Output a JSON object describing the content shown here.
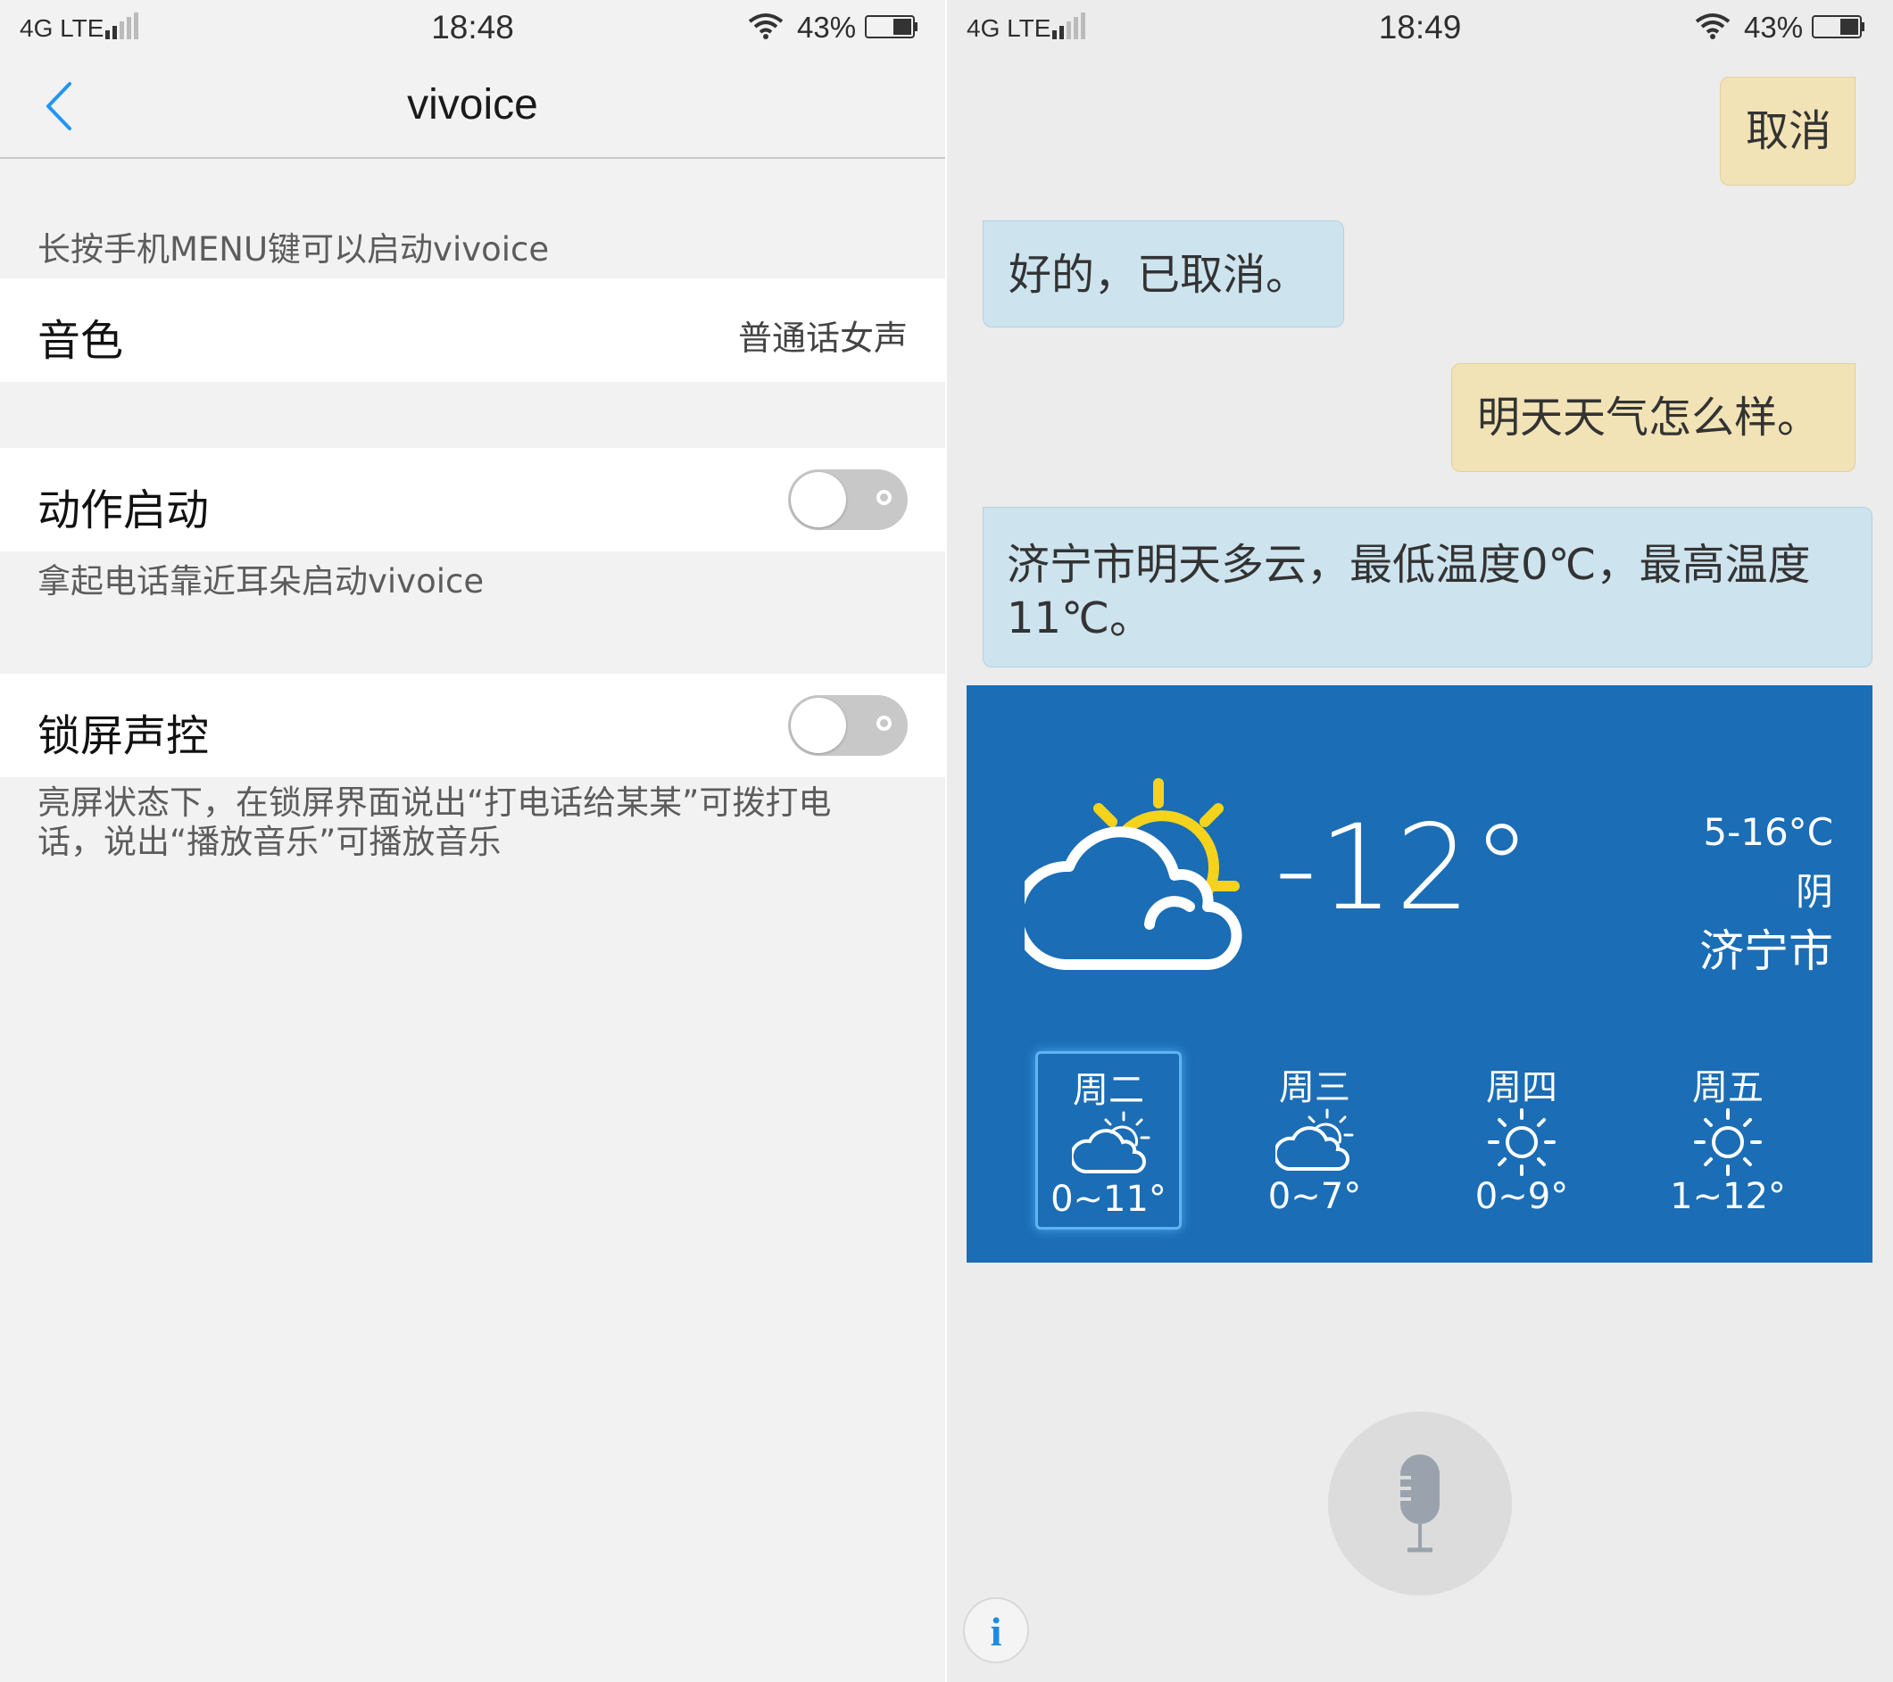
{
  "left": {
    "status": {
      "network": "4G LTE",
      "time": "18:48",
      "battery": "43%"
    },
    "title": "vivoice",
    "menu_hint": "长按手机MENU键可以启动vivoice",
    "voice": {
      "label": "音色",
      "value": "普通话女声"
    },
    "motion": {
      "label": "动作启动",
      "enabled": false,
      "hint": "拿起电话靠近耳朵启动vivoice"
    },
    "lock": {
      "label": "锁屏声控",
      "enabled": false,
      "hint_line1": "亮屏状态下，在锁屏界面说出“打电话给某某”可拨打电",
      "hint_line2": "话，说出“播放音乐”可播放音乐"
    }
  },
  "right": {
    "status": {
      "network": "4G LTE",
      "time": "18:49",
      "battery": "43%"
    },
    "messages": [
      {
        "from": "user",
        "text": "取消"
      },
      {
        "from": "bot",
        "text": "好的，已取消。"
      },
      {
        "from": "user",
        "text": "明天天气怎么样。"
      },
      {
        "from": "bot",
        "line1": "济宁市明天多云，最低温度0℃，最高温度",
        "line2": "11℃。"
      }
    ],
    "weather": {
      "current_temp": "-12°",
      "range": "5-16°C",
      "condition": "阴",
      "city": "济宁市",
      "icon": "partly-cloudy-icon",
      "forecast": [
        {
          "day": "周二",
          "range": "0~11°",
          "icon": "partly-cloudy-icon",
          "selected": true
        },
        {
          "day": "周三",
          "range": "0~7°",
          "icon": "partly-cloudy-icon",
          "selected": false
        },
        {
          "day": "周四",
          "range": "0~9°",
          "icon": "sun-icon",
          "selected": false
        },
        {
          "day": "周五",
          "range": "1~12°",
          "icon": "sun-icon",
          "selected": false
        }
      ]
    },
    "mic": "microphone-icon",
    "info": "i"
  },
  "colors": {
    "accent": "#2196f3",
    "weather_bg": "#1b6db5",
    "user_bubble": "#f1e3b6",
    "bot_bubble": "#cde3ee",
    "sun": "#f5d31c"
  }
}
